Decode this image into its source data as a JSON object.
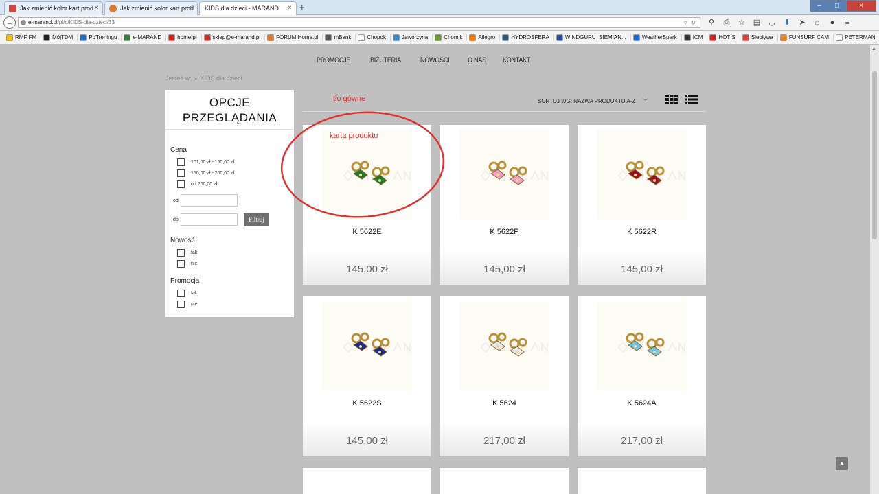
{
  "browser": {
    "tabs": [
      {
        "title": "Jak zmienić kolor kart prod...",
        "icon_color": "#d44638",
        "icon": "gmail-icon",
        "active": false
      },
      {
        "title": "Jak zmienić kolor kart prod...",
        "icon_color": "#e07a2a",
        "icon": "forum-icon",
        "active": false
      },
      {
        "title": "KIDS dla dzieci - MARAND",
        "icon_color": "#ffffff",
        "icon": "page-icon",
        "active": true
      }
    ],
    "new_tab": "+",
    "url_host": "e-marand.pl",
    "url_path": "/pl/c/KIDS-dla-dzieci/33",
    "bookmarks": [
      {
        "label": "RMF FM",
        "color": "#f0c000"
      },
      {
        "label": "MójTDM",
        "color": "#222222"
      },
      {
        "label": "PoTreningu",
        "color": "#2a6ad0"
      },
      {
        "label": "e-MARAND",
        "color": "#3a7a3a"
      },
      {
        "label": "home.pl",
        "color": "#d02020"
      },
      {
        "label": "sklep@e-marand.pl",
        "color": "#c03030"
      },
      {
        "label": "FORUM Home.pl",
        "color": "#e07a2a"
      },
      {
        "label": "mBank",
        "color": "#555555"
      },
      {
        "label": "Chopok",
        "color": "#ffffff"
      },
      {
        "label": "Jaworzyna",
        "color": "#3a8ad0"
      },
      {
        "label": "Chomik",
        "color": "#6a9a2a"
      },
      {
        "label": "Allegro",
        "color": "#f07a00"
      },
      {
        "label": "HYDROSFERA",
        "color": "#2a5a7a"
      },
      {
        "label": "WINDGURU_SIEMIAN...",
        "color": "#2a4a9a"
      },
      {
        "label": "WeatherSpark",
        "color": "#1a6ad0"
      },
      {
        "label": "ICM",
        "color": "#333333"
      },
      {
        "label": "HOTIS",
        "color": "#d02020"
      },
      {
        "label": "Siepływa",
        "color": "#e04040"
      },
      {
        "label": "FUNSURF CAM",
        "color": "#f08020"
      },
      {
        "label": "PETERMAN",
        "color": "#ffffff"
      }
    ]
  },
  "menu": [
    "PROMOCJE",
    "BIŻUTERIA",
    "NOWOŚCI",
    "O NAS",
    "KONTAKT"
  ],
  "breadcrumb": {
    "prefix": "Jesteś w:",
    "separator": "»",
    "current": "KIDS dla dzieci"
  },
  "sidebar": {
    "title_line1": "OPCJE",
    "title_line2": "PRZEGLĄDANIA",
    "price_group": "Cena",
    "price_options": [
      "101,00 zł - 150,00 zł",
      "150,00 zł - 200,00 zł",
      "od 200,00 zł"
    ],
    "from_label": "od",
    "to_label": "do",
    "filter_button": "Filtruj",
    "new_group": "Nowość",
    "new_options": [
      "tak",
      "nie"
    ],
    "promo_group": "Promocja",
    "promo_options": [
      "tak",
      "nie"
    ]
  },
  "sort": {
    "label": "SORTUJ WG: NAZWA PRODUKTU A-Z"
  },
  "annotations": {
    "background_label": "tło gówne",
    "card_label": "karta produktu",
    "color": "#e03030"
  },
  "products": [
    {
      "name": "K 5622E",
      "price": "145,00 zł",
      "stone": "#1e7a2e"
    },
    {
      "name": "K 5622P",
      "price": "145,00 zł",
      "stone": "#f2a0c8"
    },
    {
      "name": "K 5622R",
      "price": "145,00 zł",
      "stone": "#9a1020"
    },
    {
      "name": "K 5622S",
      "price": "145,00 zł",
      "stone": "#1a2a8a"
    },
    {
      "name": "K 5624",
      "price": "217,00 zł",
      "stone": "#e8e8f0"
    },
    {
      "name": "K 5624A",
      "price": "217,00 zł",
      "stone": "#6ec4ea"
    }
  ]
}
